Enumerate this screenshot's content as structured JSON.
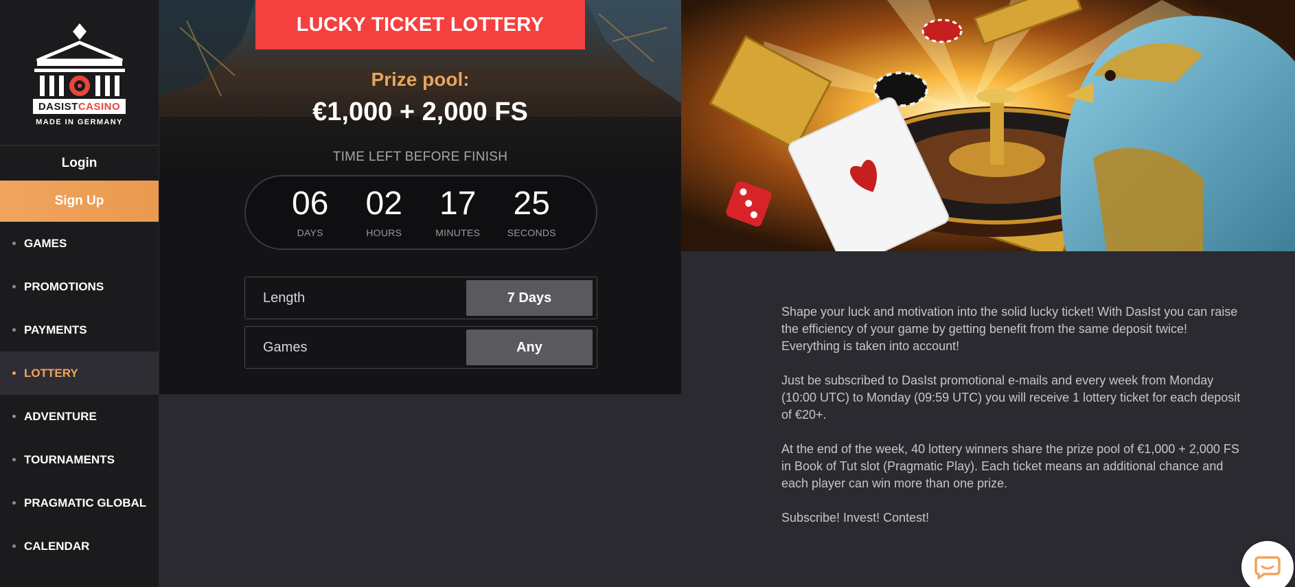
{
  "brand": {
    "name_part1": "DASIST",
    "name_part2": "CASINO",
    "tagline": "MADE IN GERMANY",
    "accent_color": "#f0a45e",
    "banner_color": "#f4403f"
  },
  "sidebar": {
    "login_label": "Login",
    "signup_label": "Sign Up",
    "items": [
      {
        "label": "GAMES",
        "active": false
      },
      {
        "label": "PROMOTIONS",
        "active": false
      },
      {
        "label": "PAYMENTS",
        "active": false
      },
      {
        "label": "LOTTERY",
        "active": true
      },
      {
        "label": "ADVENTURE",
        "active": false
      },
      {
        "label": "TOURNAMENTS",
        "active": false
      },
      {
        "label": "PRAGMATIC GLOBAL",
        "active": false
      },
      {
        "label": "CALENDAR",
        "active": false
      }
    ]
  },
  "lottery": {
    "title": "LUCKY TICKET LOTTERY",
    "prize_label": "Prize pool:",
    "prize_value": "€1,000 + 2,000 FS",
    "time_left_label": "TIME LEFT BEFORE FINISH",
    "countdown": [
      {
        "value": "06",
        "label": "DAYS"
      },
      {
        "value": "02",
        "label": "HOURS"
      },
      {
        "value": "17",
        "label": "MINUTES"
      },
      {
        "value": "25",
        "label": "SECONDS"
      }
    ],
    "details": [
      {
        "key": "Length",
        "value": "7 Days"
      },
      {
        "key": "Games",
        "value": "Any"
      }
    ]
  },
  "description": {
    "paragraphs": [
      "Shape your luck and motivation into the solid lucky ticket! With DasIst you can raise the efficiency of your game by getting benefit from the same deposit twice! Everything is taken into account!",
      "Just be subscribed to DasIst promotional e-mails and every week from Monday (10:00 UTC) to Monday (09:59 UTC) you will receive 1 lottery ticket for each deposit of €20+.",
      "At the end of the week, 40 lottery winners share the prize pool of €1,000 + 2,000 FS in Book of Tut slot (Pragmatic Play). Each ticket means an additional chance and each player can win more than one prize.",
      "Subscribe! Invest! Contest!"
    ]
  },
  "chat": {
    "icon": "chat-bubble-icon"
  }
}
